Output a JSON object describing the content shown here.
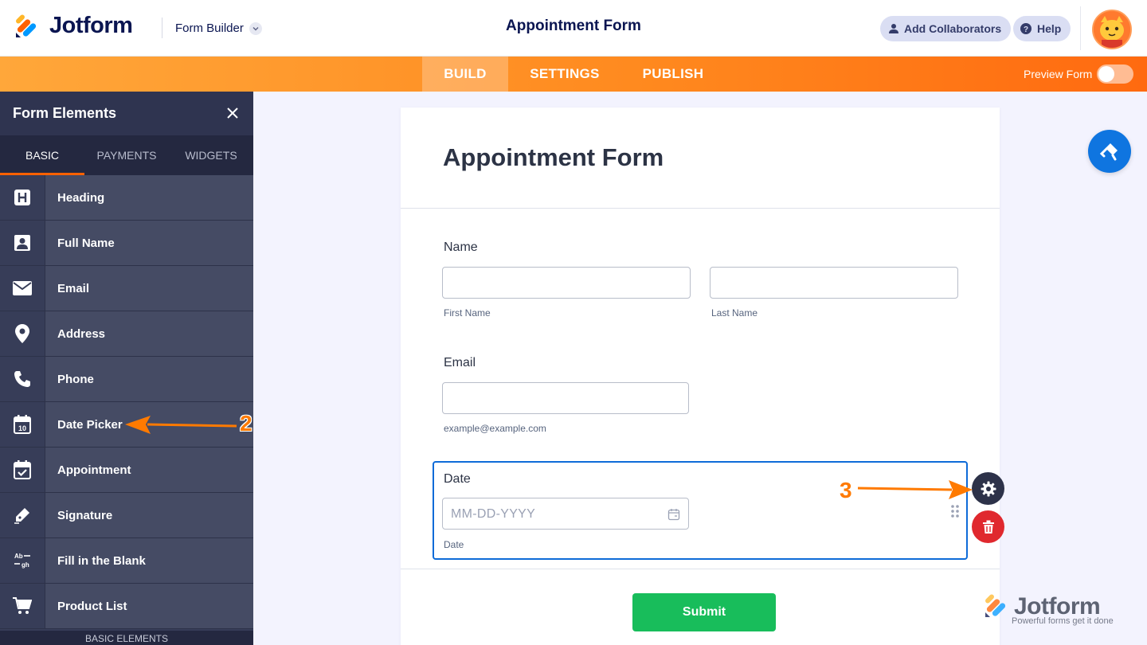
{
  "header": {
    "brand": "Jotform",
    "builder_menu": "Form Builder",
    "title": "Appointment Form",
    "collaborators_label": "Add Collaborators",
    "help_label": "Help"
  },
  "nav": {
    "tabs": [
      {
        "label": "BUILD",
        "active": true
      },
      {
        "label": "SETTINGS",
        "active": false
      },
      {
        "label": "PUBLISH",
        "active": false
      }
    ],
    "preview_label": "Preview Form",
    "preview_on": false
  },
  "sidebar": {
    "title": "Form Elements",
    "tabs": [
      {
        "label": "BASIC",
        "active": true
      },
      {
        "label": "PAYMENTS",
        "active": false
      },
      {
        "label": "WIDGETS",
        "active": false
      }
    ],
    "items": [
      {
        "label": "Heading",
        "icon": "heading-icon"
      },
      {
        "label": "Full Name",
        "icon": "user-icon"
      },
      {
        "label": "Email",
        "icon": "envelope-icon"
      },
      {
        "label": "Address",
        "icon": "map-pin-icon"
      },
      {
        "label": "Phone",
        "icon": "phone-icon"
      },
      {
        "label": "Date Picker",
        "icon": "calendar-icon"
      },
      {
        "label": "Appointment",
        "icon": "calendar-check-icon"
      },
      {
        "label": "Signature",
        "icon": "pen-icon"
      },
      {
        "label": "Fill in the Blank",
        "icon": "fill-blank-icon"
      },
      {
        "label": "Product List",
        "icon": "cart-icon"
      }
    ],
    "footer": "BASIC ELEMENTS"
  },
  "form": {
    "title": "Appointment Form",
    "name_label": "Name",
    "first_name_sublabel": "First Name",
    "last_name_sublabel": "Last Name",
    "email_label": "Email",
    "email_sublabel": "example@example.com",
    "date_label": "Date",
    "date_placeholder": "MM-DD-YYYY",
    "date_sublabel": "Date",
    "submit_label": "Submit"
  },
  "annotations": {
    "step2": "2",
    "step3": "3",
    "arrow_color": "#ff7a00"
  },
  "watermark": {
    "brand": "Jotform",
    "tagline": "Powerful forms get it done"
  },
  "colors": {
    "accent_orange": "#ff6100",
    "primary_blue": "#0e6bd8",
    "submit_green": "#18bd5b",
    "delete_red": "#e0282e"
  }
}
